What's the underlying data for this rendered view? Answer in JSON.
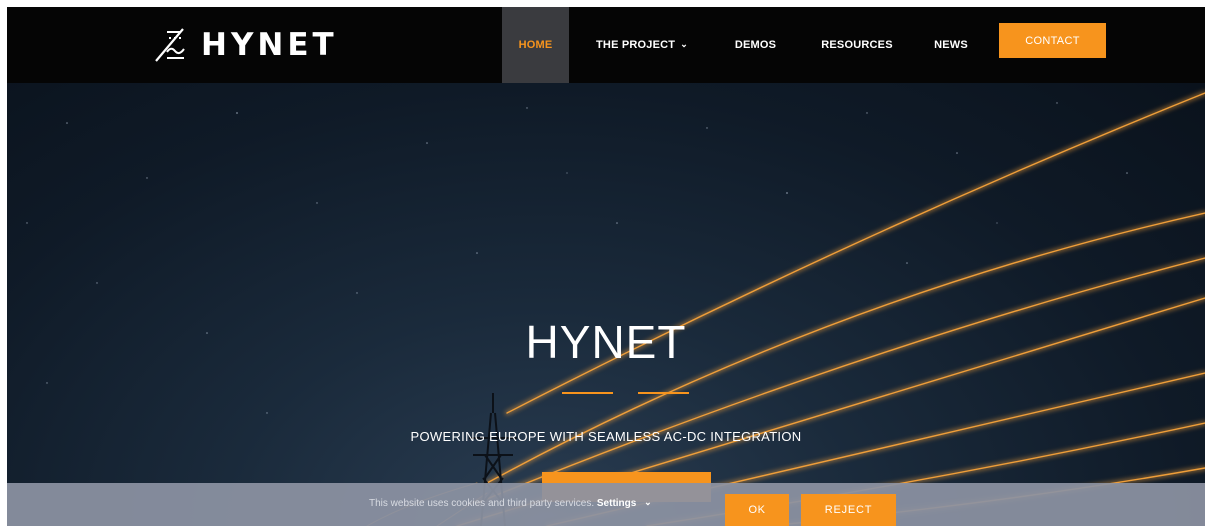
{
  "brand": {
    "name": "HYNET",
    "logo_icon": "hynet-logo-icon"
  },
  "nav": {
    "home": "HOME",
    "project": "THE PROJECT",
    "demos": "DEMOS",
    "resources": "RESOURCES",
    "news": "NEWS",
    "contact": "CONTACT",
    "chevron": "⌄"
  },
  "hero": {
    "title": "HYNET",
    "subtitle": "POWERING EUROPE WITH SEAMLESS AC-DC INTEGRATION",
    "background_image": "night sky with transmission tower and glowing power lines"
  },
  "cookie": {
    "text": "This website uses cookies and third party services.",
    "settings": "Settings",
    "ok": "OK",
    "reject": "REJECT"
  },
  "colors": {
    "accent": "#f7941d",
    "header_bg": "#050505",
    "active_nav_bg": "#3a3b3f"
  }
}
